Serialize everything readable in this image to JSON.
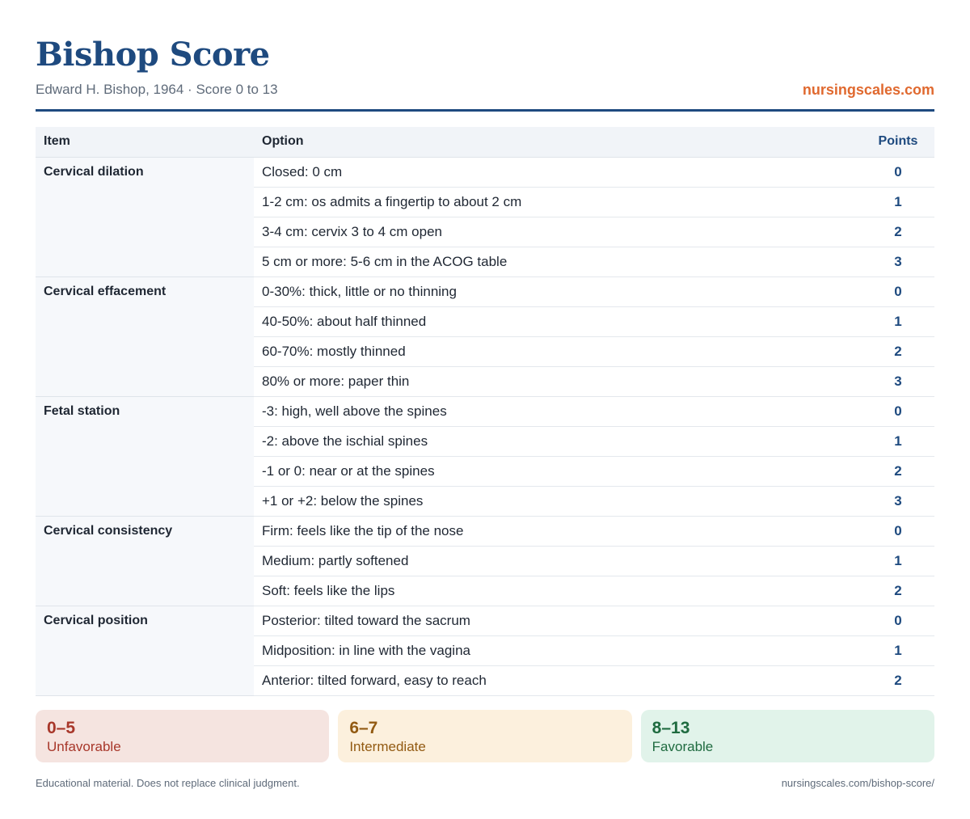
{
  "header": {
    "title": "Bishop Score",
    "subtitle": "Edward H. Bishop, 1964 · Score 0 to 13",
    "site": "nursingscales.com"
  },
  "table": {
    "col_item": "Item",
    "col_option": "Option",
    "col_points": "Points",
    "groups": [
      {
        "item": "Cervical dilation",
        "options": [
          {
            "label": "Closed: 0 cm",
            "points": "0"
          },
          {
            "label": "1-2 cm: os admits a fingertip to about 2 cm",
            "points": "1"
          },
          {
            "label": "3-4 cm: cervix 3 to 4 cm open",
            "points": "2"
          },
          {
            "label": "5 cm or more: 5-6 cm in the ACOG table",
            "points": "3"
          }
        ]
      },
      {
        "item": "Cervical effacement",
        "options": [
          {
            "label": "0-30%: thick, little or no thinning",
            "points": "0"
          },
          {
            "label": "40-50%: about half thinned",
            "points": "1"
          },
          {
            "label": "60-70%: mostly thinned",
            "points": "2"
          },
          {
            "label": "80% or more: paper thin",
            "points": "3"
          }
        ]
      },
      {
        "item": "Fetal station",
        "options": [
          {
            "label": "-3: high, well above the spines",
            "points": "0"
          },
          {
            "label": "-2: above the ischial spines",
            "points": "1"
          },
          {
            "label": "-1 or 0: near or at the spines",
            "points": "2"
          },
          {
            "label": "+1 or +2: below the spines",
            "points": "3"
          }
        ]
      },
      {
        "item": "Cervical consistency",
        "options": [
          {
            "label": "Firm: feels like the tip of the nose",
            "points": "0"
          },
          {
            "label": "Medium: partly softened",
            "points": "1"
          },
          {
            "label": "Soft: feels like the lips",
            "points": "2"
          }
        ]
      },
      {
        "item": "Cervical position",
        "options": [
          {
            "label": "Posterior: tilted toward the sacrum",
            "points": "0"
          },
          {
            "label": "Midposition: in line with the vagina",
            "points": "1"
          },
          {
            "label": "Anterior: tilted forward, easy to reach",
            "points": "2"
          }
        ]
      }
    ]
  },
  "bands": [
    {
      "range": "0–5",
      "label": "Unfavorable",
      "color": "#a8372a"
    },
    {
      "range": "6–7",
      "label": "Intermediate",
      "color": "#925a12"
    },
    {
      "range": "8–13",
      "label": "Favorable",
      "color": "#1f6b40"
    }
  ],
  "footer": {
    "disclaimer": "Educational material. Does not replace clinical judgment.",
    "url": "nursingscales.com/bishop-score/"
  }
}
